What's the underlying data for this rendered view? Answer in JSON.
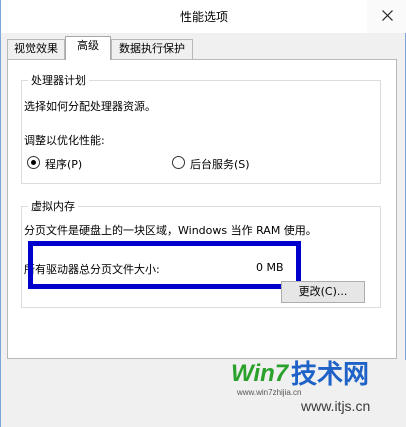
{
  "window": {
    "title": "性能选项"
  },
  "tabs": [
    {
      "label": "视觉效果"
    },
    {
      "label": "高级"
    },
    {
      "label": "数据执行保护"
    }
  ],
  "processor_group": {
    "title": "处理器计划",
    "description": "选择如何分配处理器资源。",
    "optimize_label": "调整以优化性能:",
    "option_programs": "程序(P)",
    "option_background": "后台服务(S)",
    "selected": "程序(P)"
  },
  "vm_group": {
    "title": "虚拟内存",
    "description": "分页文件是硬盘上的一块区域，Windows 当作 RAM 使用。",
    "total_label": "所有驱动器总分页文件大小:",
    "total_value": "0 MB",
    "change_button": "更改(C)..."
  },
  "watermark": {
    "logo_text": "Win7技术网",
    "url": "www.itjs.cn"
  },
  "colors": {
    "highlight_border": "#0000cc",
    "logo_green": "#2aa12a",
    "logo_blue": "#1e62c8"
  }
}
